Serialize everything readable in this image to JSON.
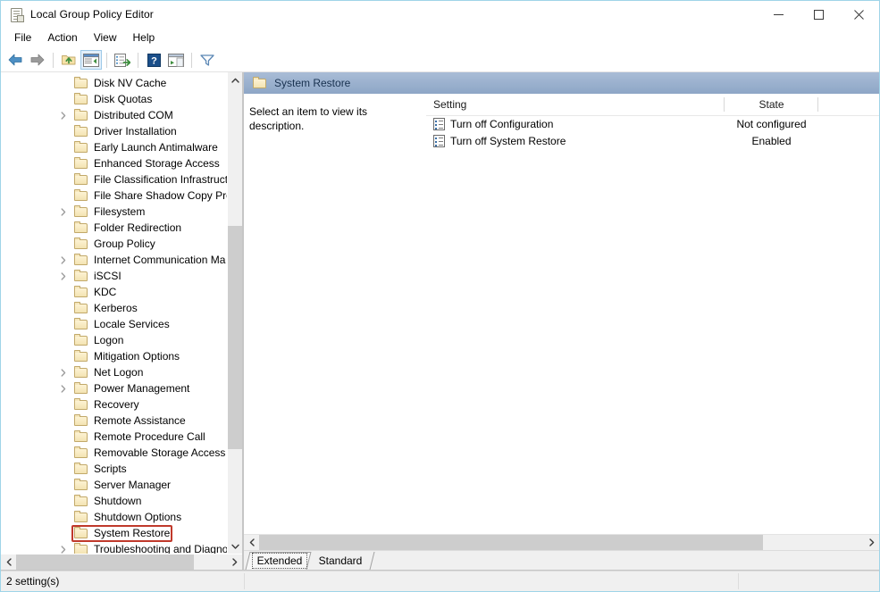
{
  "window": {
    "title": "Local Group Policy Editor",
    "title_icon": "policy-document-icon",
    "minimize_label": "—",
    "maximize_label": "□",
    "close_label": "✕"
  },
  "menubar": {
    "items": [
      {
        "label": "File"
      },
      {
        "label": "Action"
      },
      {
        "label": "View"
      },
      {
        "label": "Help"
      }
    ]
  },
  "toolbar": {
    "buttons": [
      {
        "name": "back-button",
        "icon": "arrow-left-icon"
      },
      {
        "name": "forward-button",
        "icon": "arrow-right-icon"
      },
      {
        "name": "up-one-level-button",
        "icon": "folder-up-icon"
      },
      {
        "name": "show-hide-console-tree-button",
        "icon": "console-tree-icon"
      },
      {
        "name": "export-list-button",
        "icon": "export-list-icon"
      },
      {
        "name": "help-button",
        "icon": "question-mark-icon"
      },
      {
        "name": "show-hide-action-pane-button",
        "icon": "action-pane-icon"
      },
      {
        "name": "filter-button",
        "icon": "funnel-filter-icon"
      }
    ]
  },
  "tree": {
    "items": [
      {
        "label": "Disk NV Cache",
        "expandable": false,
        "highlighted": false
      },
      {
        "label": "Disk Quotas",
        "expandable": false,
        "highlighted": false
      },
      {
        "label": "Distributed COM",
        "expandable": true,
        "highlighted": false
      },
      {
        "label": "Driver Installation",
        "expandable": false,
        "highlighted": false
      },
      {
        "label": "Early Launch Antimalware",
        "expandable": false,
        "highlighted": false
      },
      {
        "label": "Enhanced Storage Access",
        "expandable": false,
        "highlighted": false
      },
      {
        "label": "File Classification Infrastructu",
        "expandable": false,
        "highlighted": false
      },
      {
        "label": "File Share Shadow Copy Prov",
        "expandable": false,
        "highlighted": false
      },
      {
        "label": "Filesystem",
        "expandable": true,
        "highlighted": false
      },
      {
        "label": "Folder Redirection",
        "expandable": false,
        "highlighted": false
      },
      {
        "label": "Group Policy",
        "expandable": false,
        "highlighted": false
      },
      {
        "label": "Internet Communication Ma",
        "expandable": true,
        "highlighted": false
      },
      {
        "label": "iSCSI",
        "expandable": true,
        "highlighted": false
      },
      {
        "label": "KDC",
        "expandable": false,
        "highlighted": false
      },
      {
        "label": "Kerberos",
        "expandable": false,
        "highlighted": false
      },
      {
        "label": "Locale Services",
        "expandable": false,
        "highlighted": false
      },
      {
        "label": "Logon",
        "expandable": false,
        "highlighted": false
      },
      {
        "label": "Mitigation Options",
        "expandable": false,
        "highlighted": false
      },
      {
        "label": "Net Logon",
        "expandable": true,
        "highlighted": false
      },
      {
        "label": "Power Management",
        "expandable": true,
        "highlighted": false
      },
      {
        "label": "Recovery",
        "expandable": false,
        "highlighted": false
      },
      {
        "label": "Remote Assistance",
        "expandable": false,
        "highlighted": false
      },
      {
        "label": "Remote Procedure Call",
        "expandable": false,
        "highlighted": false
      },
      {
        "label": "Removable Storage Access",
        "expandable": false,
        "highlighted": false
      },
      {
        "label": "Scripts",
        "expandable": false,
        "highlighted": false
      },
      {
        "label": "Server Manager",
        "expandable": false,
        "highlighted": false
      },
      {
        "label": "Shutdown",
        "expandable": false,
        "highlighted": false
      },
      {
        "label": "Shutdown Options",
        "expandable": false,
        "highlighted": false
      },
      {
        "label": "System Restore",
        "expandable": false,
        "highlighted": true
      },
      {
        "label": "Troubleshooting and Diagno",
        "expandable": true,
        "highlighted": false
      }
    ],
    "highlight_color": "#c0392b"
  },
  "right_pane": {
    "header_title": "System Restore",
    "header_icon": "folder-icon",
    "description": "Select an item to view its description.",
    "columns": [
      {
        "label": "Setting"
      },
      {
        "label": "State"
      },
      {
        "label": ""
      }
    ],
    "rows": [
      {
        "setting": "Turn off Configuration",
        "state": "Not configured",
        "icon": "policy-setting-icon"
      },
      {
        "setting": "Turn off System Restore",
        "state": "Enabled",
        "icon": "policy-setting-icon"
      }
    ]
  },
  "tabs": [
    {
      "label": "Extended",
      "selected": true
    },
    {
      "label": "Standard",
      "selected": false
    }
  ],
  "statusbar": {
    "text": "2 setting(s)"
  }
}
